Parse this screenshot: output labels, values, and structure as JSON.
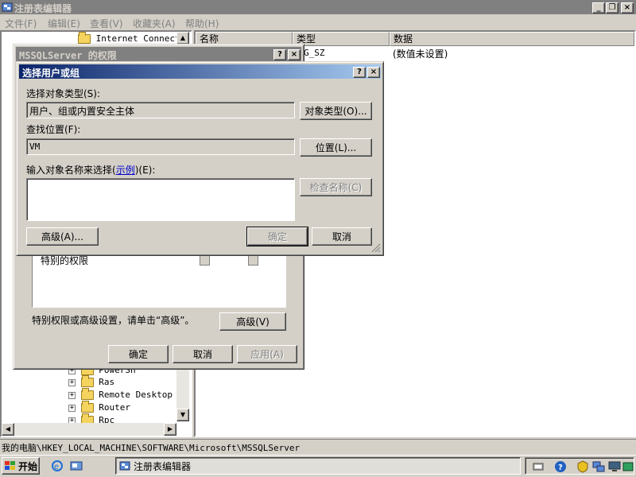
{
  "main": {
    "title": "注册表编辑器",
    "menu": [
      "文件(F)",
      "编辑(E)",
      "查看(V)",
      "收藏夹(A)",
      "帮助(H)"
    ],
    "tree_items": [
      "Internet Connecti",
      "PowerSh",
      "Ras",
      "Remote Desktop",
      "Router",
      "Rpc"
    ],
    "columns": [
      "名称",
      "类型",
      "数据"
    ],
    "row": {
      "type": "G_SZ",
      "data": "(数值未设置)"
    },
    "status": "我的电脑\\HKEY_LOCAL_MACHINE\\SOFTWARE\\Microsoft\\MSSQLServer"
  },
  "perm": {
    "title": "MSSQLServer 的权限",
    "special_label": "特别的权限",
    "advanced_text": "特别权限或高级设置，请单击“高级”。",
    "advanced_btn": "高级(V)",
    "ok": "确定",
    "cancel": "取消",
    "apply": "应用(A)"
  },
  "select": {
    "title": "选择用户或组",
    "obj_type_label": "选择对象类型(S):",
    "obj_type_value": "用户、组或内置安全主体",
    "obj_type_btn": "对象类型(O)...",
    "location_label": "查找位置(F):",
    "location_value": "VM",
    "location_btn": "位置(L)...",
    "input_label_prefix": "输入对象名称来选择(",
    "input_label_link": "示例",
    "input_label_suffix": ")(E):",
    "input_value": "",
    "check_btn": "检查名称(C)",
    "advanced_btn": "高级(A)...",
    "ok": "确定",
    "cancel": "取消"
  },
  "taskbar": {
    "start": "开始",
    "task": "注册表编辑器"
  }
}
